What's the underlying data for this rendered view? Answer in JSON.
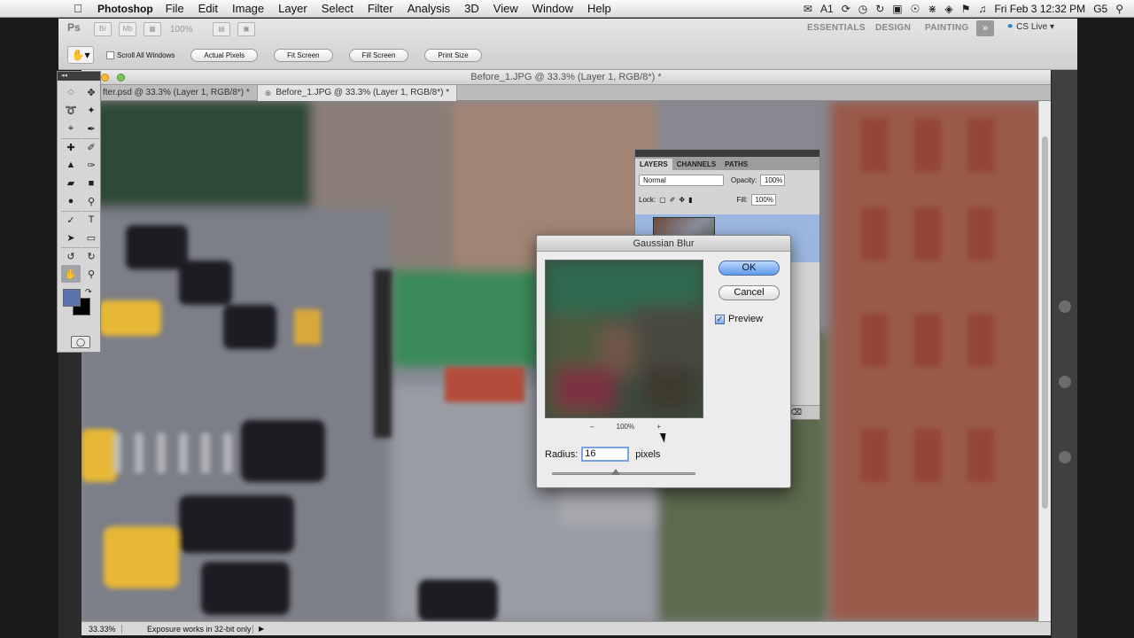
{
  "menubar": {
    "app_name": "Photoshop",
    "items": [
      "File",
      "Edit",
      "Image",
      "Layer",
      "Select",
      "Filter",
      "Analysis",
      "3D",
      "View",
      "Window",
      "Help"
    ],
    "status_num": "1",
    "clock": "Fri Feb 3  12:32 PM",
    "version": "G5"
  },
  "appbar": {
    "logo": "Ps",
    "zoom": "100%",
    "workspaces": [
      "ESSENTIALS",
      "DESIGN",
      "PAINTING"
    ],
    "more": "»",
    "cs_live": "CS Live"
  },
  "tool_options": {
    "scroll_all": "Scroll All Windows",
    "buttons": [
      "Actual Pixels",
      "Fit Screen",
      "Fill Screen",
      "Print Size"
    ]
  },
  "document": {
    "window_title": "Before_1.JPG @ 33.3% (Layer 1, RGB/8*) *",
    "tabs": [
      {
        "label": "fter.psd @ 33.3% (Layer 1, RGB/8*) *",
        "active": false
      },
      {
        "label": "Before_1.JPG @ 33.3% (Layer 1, RGB/8*) *",
        "active": true
      }
    ],
    "zoom": "33.33%",
    "status_info": "Exposure works in 32-bit only"
  },
  "layers_panel": {
    "tabs": [
      "LAYERS",
      "CHANNELS",
      "PATHS"
    ],
    "blend_mode": "Normal",
    "opacity_label": "Opacity:",
    "opacity": "100%",
    "lock_label": "Lock:",
    "fill_label": "Fill:",
    "fill": "100%"
  },
  "dialog": {
    "title": "Gaussian Blur",
    "ok": "OK",
    "cancel": "Cancel",
    "preview_label": "Preview",
    "preview_checked": true,
    "zoom": "100%",
    "zoom_minus": "–",
    "zoom_plus": "+",
    "radius_label": "Radius:",
    "radius_value": "16",
    "radius_unit": "pixels"
  },
  "colors": {
    "foreground": "#5a73ad",
    "background": "#000000",
    "accent": "#5f9ae8"
  }
}
